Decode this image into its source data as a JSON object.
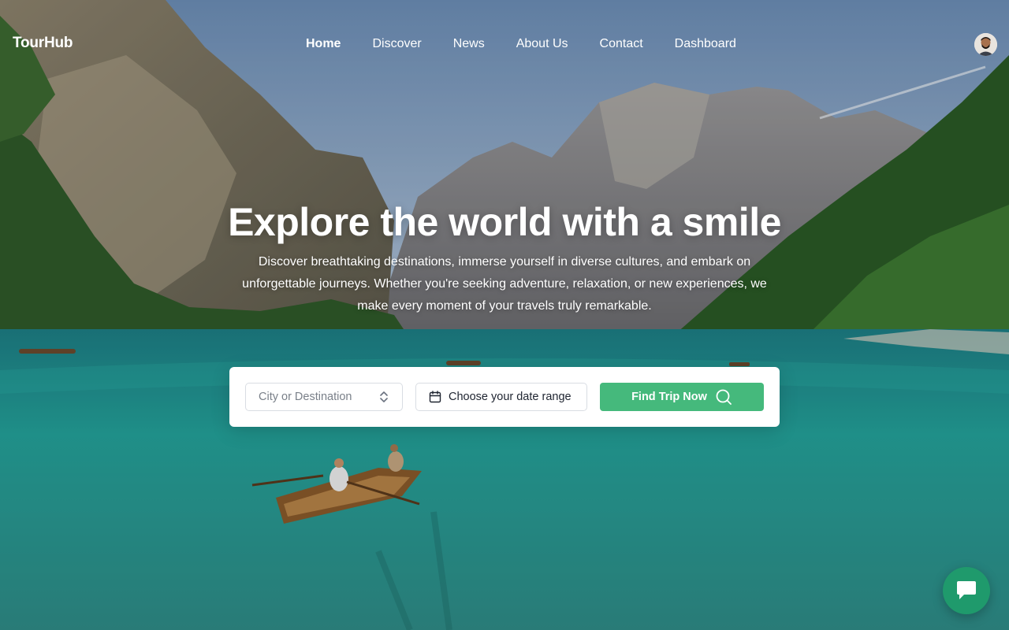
{
  "app": {
    "brand": "TourHub"
  },
  "nav": {
    "items": [
      {
        "label": "Home",
        "active": true
      },
      {
        "label": "Discover",
        "active": false
      },
      {
        "label": "News",
        "active": false
      },
      {
        "label": "About Us",
        "active": false
      },
      {
        "label": "Contact",
        "active": false
      },
      {
        "label": "Dashboard",
        "active": false
      }
    ]
  },
  "hero": {
    "title": "Explore the world with a smile",
    "description": "Discover breathtaking destinations, immerse yourself in diverse cultures, and embark on unforgettable journeys. Whether you're seeking adventure, relaxation, or new experiences, we make every moment of your travels truly remarkable."
  },
  "search": {
    "destination_placeholder": "City or Destination",
    "date_placeholder": "Choose your date range",
    "button_label": "Find Trip Now"
  },
  "icons": {
    "destination_chevron": "chevron-up-down-icon",
    "date": "calendar-icon",
    "find": "search-icon",
    "chat": "chat-icon",
    "avatar": "user-avatar"
  },
  "colors": {
    "accent": "#45b97c",
    "chat": "#1f9a6c",
    "text_on_image": "#ffffff"
  }
}
